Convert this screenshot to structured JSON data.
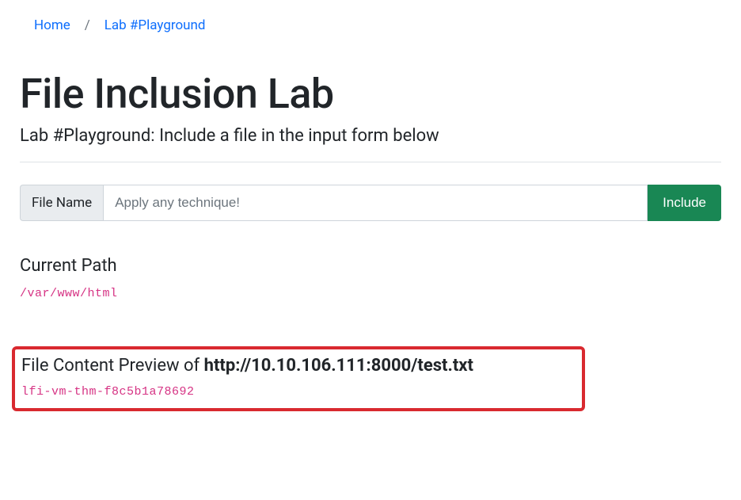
{
  "breadcrumb": {
    "home": "Home",
    "sep": "/",
    "current": "Lab #Playground"
  },
  "page": {
    "title": "File Inclusion Lab",
    "lead": "Lab #Playground: Include a file in the input form below"
  },
  "form": {
    "label": "File Name",
    "placeholder": "Apply any technique!",
    "value": "",
    "button": "Include"
  },
  "current_path": {
    "heading": "Current Path",
    "value": "/var/www/html"
  },
  "preview": {
    "heading_prefix": "File Content Preview of ",
    "url": "http://10.10.106.111:8000/test.txt",
    "content": "lfi-vm-thm-f8c5b1a78692"
  }
}
